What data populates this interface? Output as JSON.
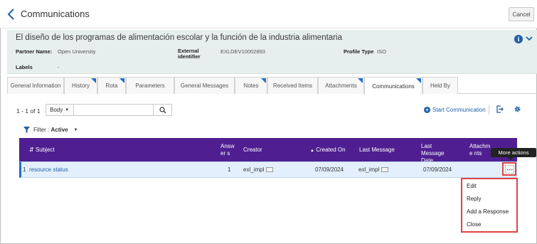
{
  "header": {
    "title": "Communications",
    "cancel_label": "Cancel"
  },
  "record": {
    "title": "El diseño de los programas de alimentación escolar y la función de la industria alimentaria",
    "partner_label": "Partner Name:",
    "partner_value": "Open University",
    "external_label": "External identifier",
    "external_value": "EXLDEV10002893",
    "profile_label": "Profile Type",
    "profile_value": "ISO",
    "labels_label": "Labels",
    "labels_value": "-"
  },
  "tabs": [
    {
      "label": "General Information",
      "marked": false
    },
    {
      "label": "History",
      "marked": true
    },
    {
      "label": "Rota",
      "marked": true
    },
    {
      "label": "Parameters",
      "marked": false
    },
    {
      "label": "General Messages",
      "marked": false
    },
    {
      "label": "Notes",
      "marked": true
    },
    {
      "label": "Received Items",
      "marked": false
    },
    {
      "label": "Attachments",
      "marked": true
    },
    {
      "label": "Communications",
      "marked": true,
      "active": true
    },
    {
      "label": "Held By",
      "marked": false
    }
  ],
  "toolbar": {
    "pager": "1 - 1 of 1",
    "search_scope": "Body",
    "search_value": "",
    "start_communication": "Start Communication"
  },
  "filter": {
    "label": "Filter :",
    "value": "Active"
  },
  "table": {
    "columns": {
      "subject": "Subject",
      "answers": "Answer s",
      "creator": "Creator",
      "created_on": "Created On",
      "last_message": "Last Message",
      "last_message_date": "Last Message Date",
      "attachments": "Attachme nts"
    },
    "rows": [
      {
        "index": "1",
        "subject": "resource status",
        "answers": "1",
        "creator": "exl_impl",
        "created_on": "07/09/2024",
        "last_message": "exl_impl",
        "last_message_date": "07/09/2024",
        "attachments": ""
      }
    ]
  },
  "row_actions": {
    "tooltip": "More actions",
    "items": [
      "Edit",
      "Reply",
      "Add a Response",
      "Close"
    ]
  },
  "colors": {
    "accent": "#4f1f91",
    "link": "#1f5fa8",
    "highlight": "#e04444",
    "row_selected": "#e3effc"
  }
}
